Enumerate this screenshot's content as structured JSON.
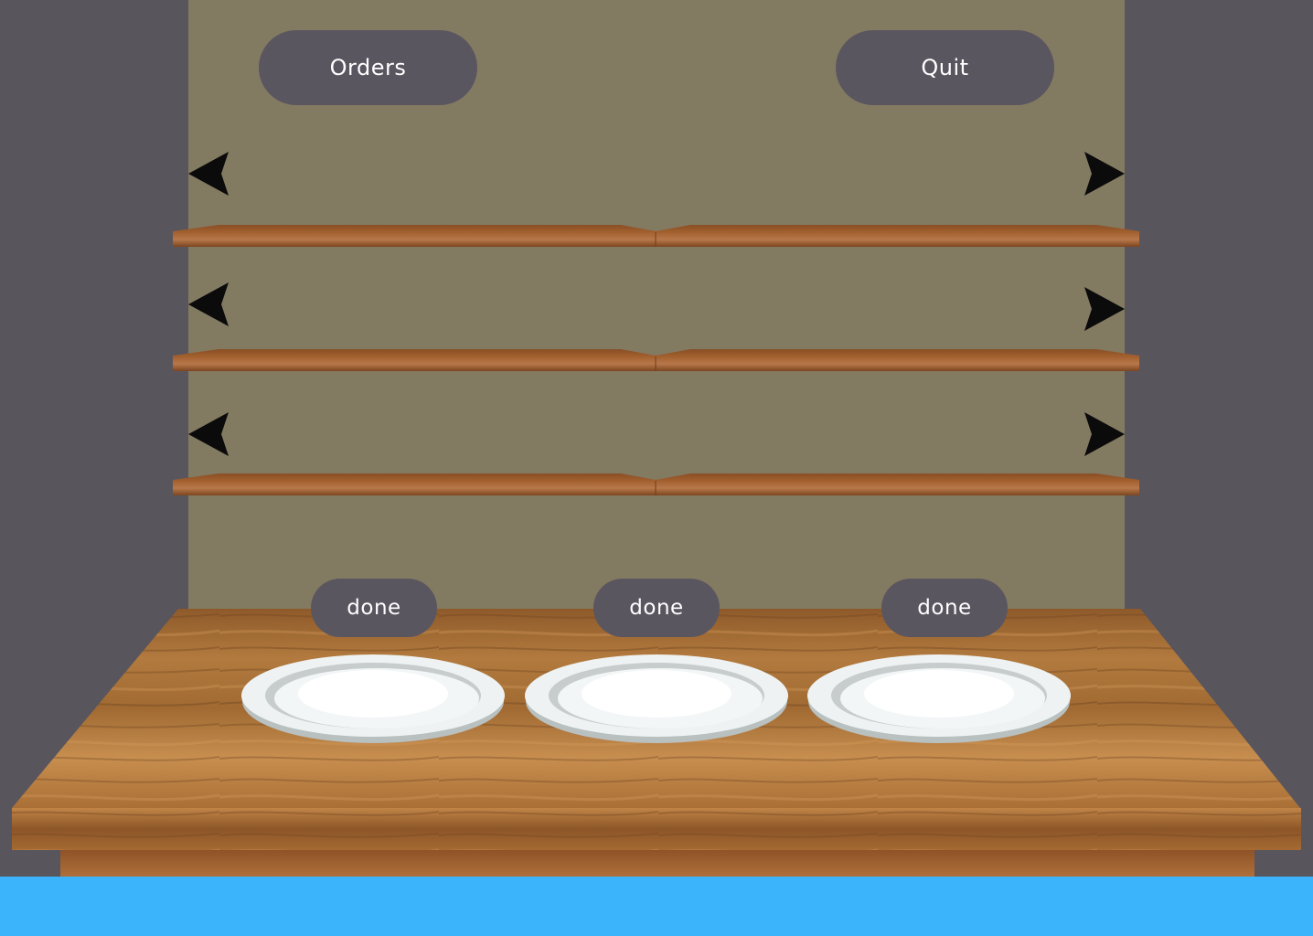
{
  "top_buttons": {
    "orders_label": "Orders",
    "quit_label": "Quit"
  },
  "shelves": [
    {
      "left_arrow": "left-arrow-icon",
      "right_arrow": "right-arrow-icon"
    },
    {
      "left_arrow": "left-arrow-icon",
      "right_arrow": "right-arrow-icon"
    },
    {
      "left_arrow": "left-arrow-icon",
      "right_arrow": "right-arrow-icon"
    }
  ],
  "plates": [
    {
      "done_label": "done"
    },
    {
      "done_label": "done"
    },
    {
      "done_label": "done"
    }
  ],
  "colors": {
    "wall": "#837a62",
    "side_wall": "#58555d",
    "button": "#5a5660",
    "floor": "#3bb4fc",
    "wood": "#a8672c"
  }
}
